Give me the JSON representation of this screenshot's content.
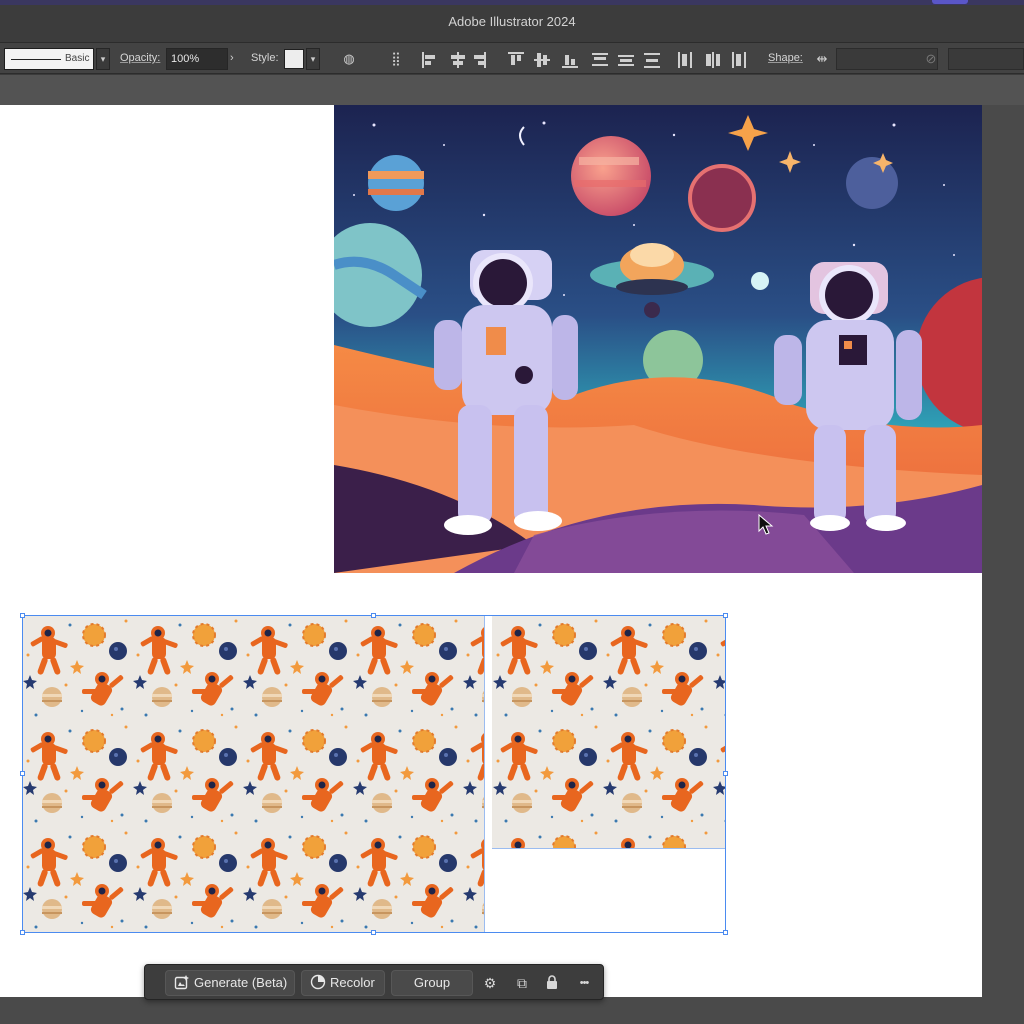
{
  "app": {
    "title": "Adobe Illustrator 2024"
  },
  "control_bar": {
    "stroke_profile": "Basic",
    "opacity_label": "Opacity:",
    "opacity_value": "100%",
    "style_label": "Style:",
    "shape_label": "Shape:"
  },
  "task_bar": {
    "generate_label": "Generate (Beta)",
    "recolor_label": "Recolor",
    "group_label": "Group",
    "more_label": "•••"
  },
  "colors": {
    "selection": "#4b8bf0",
    "pattern_bg": "#ece9e4",
    "astronaut_orange": "#e8661f",
    "space_top": "#1c2450",
    "ground_orange": "#f07a3a"
  },
  "icons": [
    "chevron-down-icon",
    "chevron-right-icon",
    "recolor-globe-icon",
    "align-icons",
    "generate-icon",
    "recolor-icon",
    "settings-icon",
    "arrange-icon",
    "lock-icon"
  ]
}
